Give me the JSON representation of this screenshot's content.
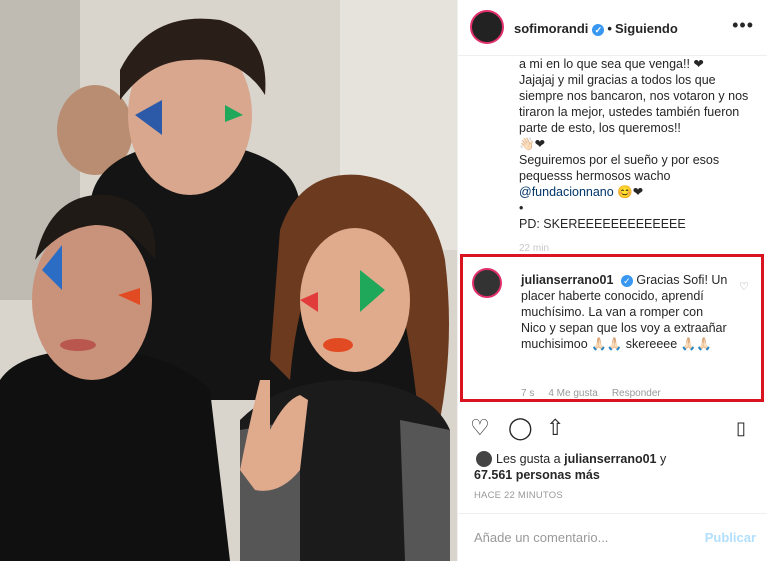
{
  "post": {
    "username": "sofimorandi",
    "follow_status": "Siguiendo",
    "more_icon": "•••",
    "verified_icon": "✓"
  },
  "caption": {
    "line1": "a mi en lo que sea que venga!! ❤",
    "line2": "Jajajaj y mil gracias a todos los que siempre nos bancaron, nos votaron y nos tiraron la mejor, ustedes también fueron parte de esto, los queremos!!",
    "line3": "👋🏻❤",
    "line4": "Seguiremos por el sueño y por esos pequesss hermosos wacho",
    "mention": "@fundacionnano",
    "mention_suffix": " 😊❤",
    "bullet": "•",
    "ps": "PD: SKEREEEEEEEEEEEEE",
    "time": "22 min"
  },
  "comment": {
    "username": "julianserrano01",
    "text": "Gracias Sofi! Un placer haberte conocido, aprendí muchísimo. La van a romper con Nico y sepan que los voy a extraañar muchisimoo 🙏🏻🙏🏻 skereeee 🙏🏻🙏🏻",
    "time": "7 s",
    "likes": "4 Me gusta",
    "reply": "Responder",
    "heart_icon": "♡"
  },
  "likes": {
    "line1_prefix": "Les gusta a ",
    "line1_user": "julianserrano01",
    "line1_suffix": " y",
    "line2": "67.561 personas más"
  },
  "time_ago": "HACE 22 MINUTOS",
  "add_comment": {
    "placeholder": "Añade un comentario...",
    "publish": "Publicar"
  },
  "icons": {
    "heart": "♡",
    "comment": "◯",
    "share": "⇧",
    "bookmark": "🔖"
  }
}
